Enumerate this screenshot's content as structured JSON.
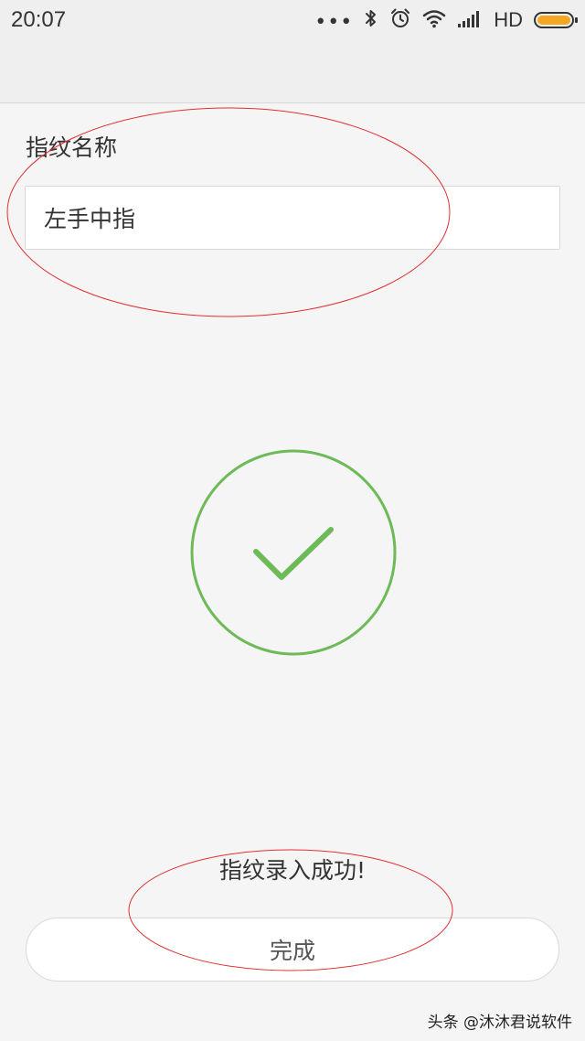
{
  "status_bar": {
    "time": "20:07",
    "more_dots": "•••",
    "network_label": "HD",
    "battery_level": 1.0,
    "battery_color": "#f5a623",
    "icons": [
      "more-dots-icon",
      "bluetooth-icon",
      "alarm-icon",
      "wifi-icon",
      "signal-icon",
      "battery-icon"
    ]
  },
  "form": {
    "label": "指纹名称",
    "input_value": "左手中指"
  },
  "result": {
    "icon": "checkmark-circle-icon",
    "icon_color": "#6dba58",
    "message": "指纹录入成功!"
  },
  "actions": {
    "done_label": "完成"
  },
  "watermark": "头条 @沐沐君说软件",
  "annotation_color": "#e03030"
}
